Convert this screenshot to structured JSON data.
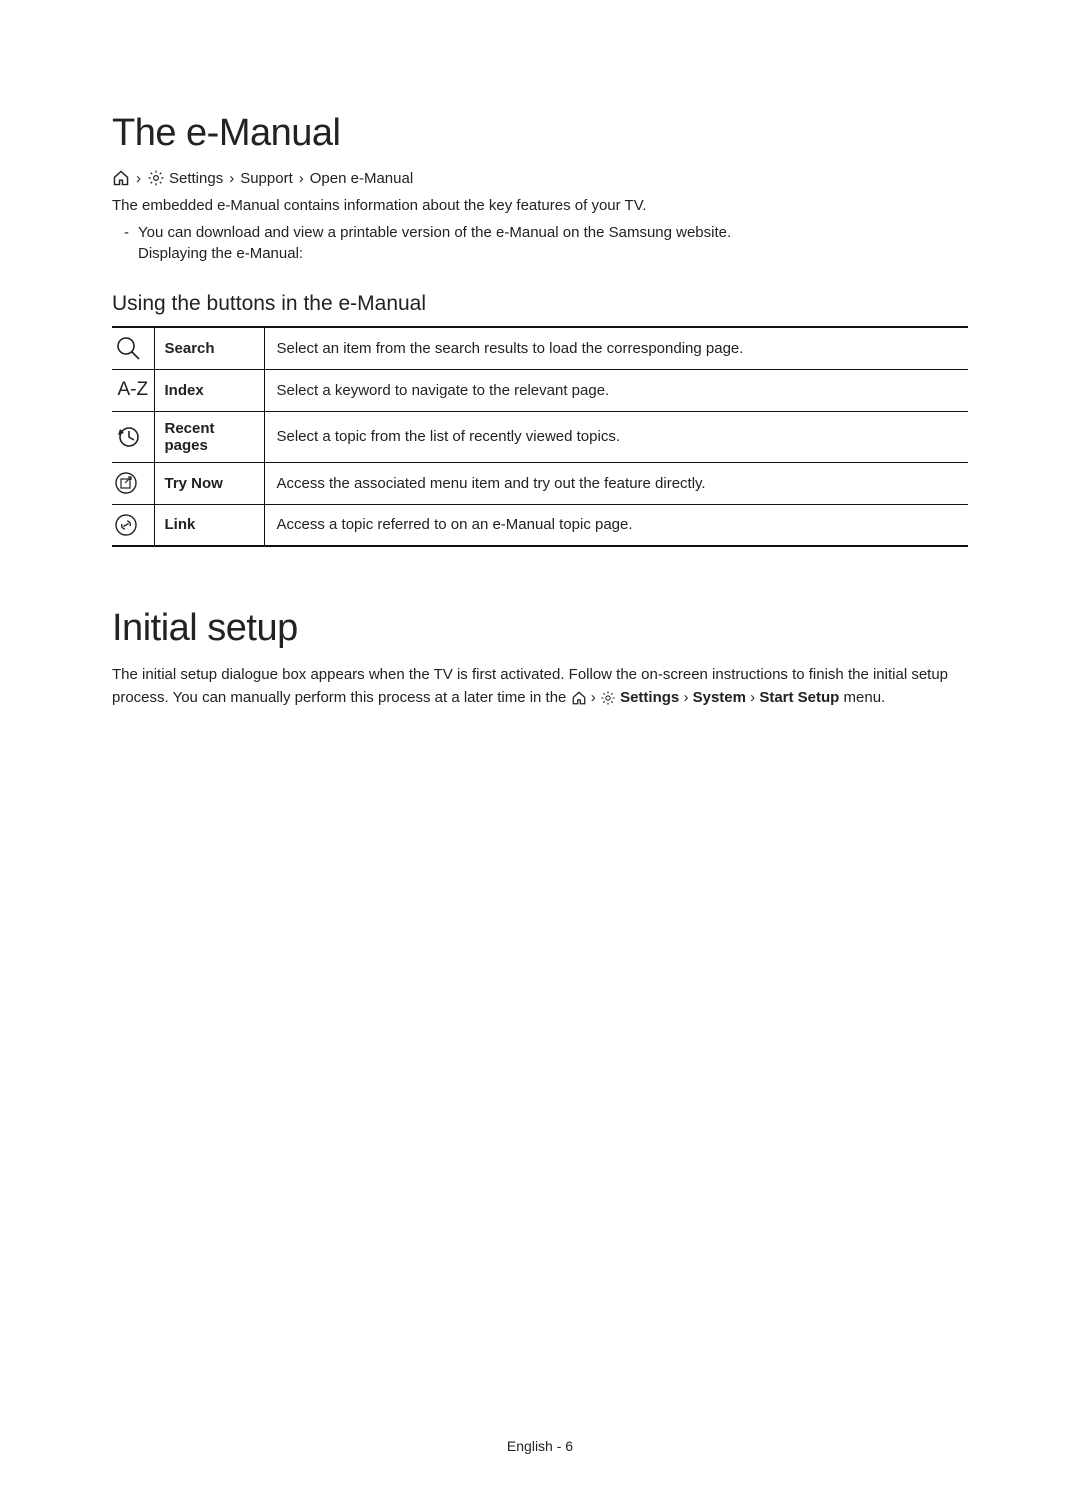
{
  "section1": {
    "title": "The e-Manual",
    "breadcrumb": {
      "settings": "Settings",
      "support": "Support",
      "open": "Open e-Manual"
    },
    "intro": "The embedded e-Manual contains information about the key features of your TV.",
    "note1": "You can download and view a printable version of the e-Manual on the Samsung website.",
    "note2": "Displaying the e-Manual:",
    "subheading": "Using the buttons in the e-Manual",
    "rows": [
      {
        "label": "Search",
        "desc": "Select an item from the search results to load the corresponding page."
      },
      {
        "label": "Index",
        "desc": "Select a keyword to navigate to the relevant page."
      },
      {
        "label": "Recent pages",
        "desc": "Select a topic from the list of recently viewed topics."
      },
      {
        "label": "Try Now",
        "desc": "Access the associated menu item and try out the feature directly."
      },
      {
        "label": "Link",
        "desc": "Access a topic referred to on an e-Manual topic page."
      }
    ]
  },
  "section2": {
    "title": "Initial setup",
    "para_pre": "The initial setup dialogue box appears when the TV is first activated. Follow the on-screen instructions to finish the initial setup process. You can manually perform this process at a later time in the ",
    "settings": "Settings",
    "system": "System",
    "start": "Start Setup",
    "para_post": " menu."
  },
  "footer": "English - 6"
}
